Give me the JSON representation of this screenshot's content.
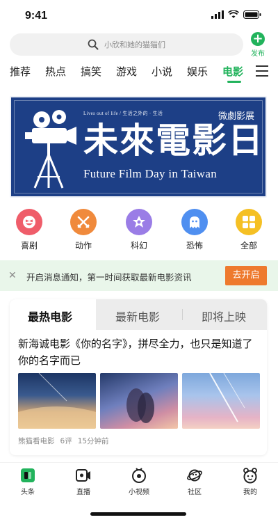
{
  "status_bar": {
    "time": "9:41"
  },
  "search": {
    "placeholder": "小欣和她的猫猫们"
  },
  "publish": {
    "label": "发布"
  },
  "tabs": [
    {
      "label": "推荐"
    },
    {
      "label": "热点"
    },
    {
      "label": "搞笑"
    },
    {
      "label": "游戏"
    },
    {
      "label": "小说"
    },
    {
      "label": "娱乐"
    },
    {
      "label": "电影",
      "active": true
    }
  ],
  "banner": {
    "small_text": "Lives out of life / 生活之外的 · 生活",
    "tag": "微劇影展",
    "title": "未來電影日",
    "subtitle": "Future Film Day in Taiwan"
  },
  "categories": [
    {
      "label": "喜剧",
      "color": "#ef5d6a",
      "icon": "smile-icon"
    },
    {
      "label": "动作",
      "color": "#f08a3c",
      "icon": "swords-icon"
    },
    {
      "label": "科幻",
      "color": "#9a7de6",
      "icon": "star-icon"
    },
    {
      "label": "恐怖",
      "color": "#4f8ff0",
      "icon": "ghost-icon"
    },
    {
      "label": "全部",
      "color": "#f5c024",
      "icon": "grid-icon"
    }
  ],
  "notification": {
    "text": "开启消息通知，第一时间获取最新电影资讯",
    "button": "去开启"
  },
  "card": {
    "tabs": [
      {
        "label": "最热电影",
        "active": true
      },
      {
        "label": "最新电影"
      },
      {
        "label": "即将上映"
      }
    ],
    "article_title": "新海诚电影《你的名字》，拼尽全力，也只是知道了你的名字而已",
    "meta": {
      "source": "熊猫看电影",
      "comments": "6评",
      "time": "15分钟前"
    }
  },
  "bottom_nav": [
    {
      "label": "头条",
      "icon": "news-icon"
    },
    {
      "label": "直播",
      "icon": "live-icon"
    },
    {
      "label": "小视频",
      "icon": "short-video-icon"
    },
    {
      "label": "社区",
      "icon": "community-icon"
    },
    {
      "label": "我的",
      "icon": "profile-icon"
    }
  ],
  "colors": {
    "accent": "#22b35c",
    "banner_bg": "#1d3f86",
    "notify_bg": "#e9f6ea",
    "notify_btn": "#ee7a2e"
  }
}
